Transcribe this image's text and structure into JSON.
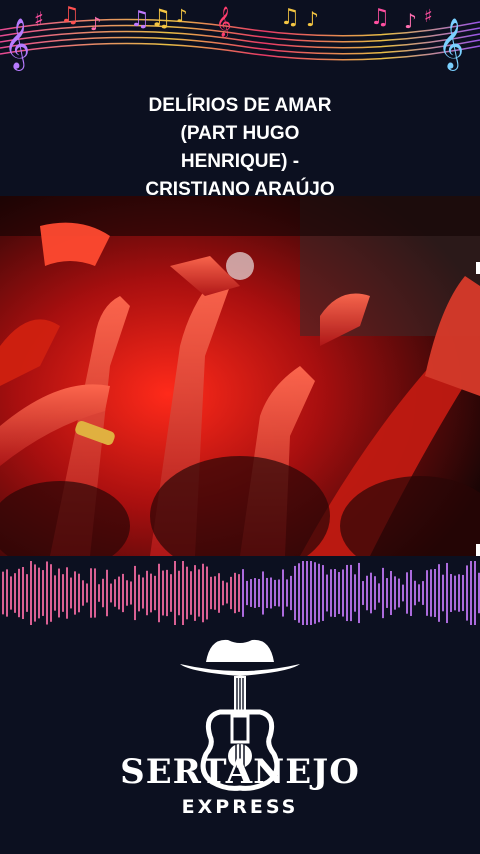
{
  "song": {
    "title_lines": [
      "DELÍRIOS DE AMAR",
      "(PART HUGO",
      "HENRIQUE) -",
      "CRISTIANO ARAÚJO"
    ]
  },
  "brand": {
    "name": "SERTANEJO",
    "tagline": "EXPRESS"
  },
  "icons": {
    "banner": "music-notes-icon",
    "logo": "cowboy-hat-guitar-icon"
  },
  "colors": {
    "background": "#0c1020",
    "accent_pink": "#ff4fa0",
    "accent_purple": "#9b5cff",
    "accent_gold": "#f4c542",
    "stage_red": "#e01818"
  }
}
